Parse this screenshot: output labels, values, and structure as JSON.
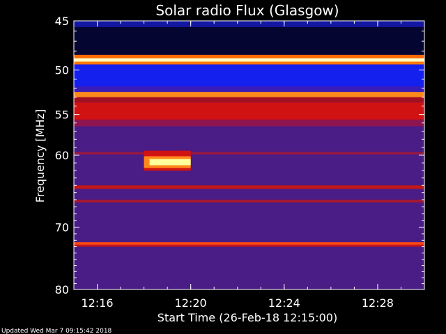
{
  "chart_data": {
    "type": "heatmap",
    "title": "Solar radio Flux (Glasgow)",
    "xlabel": "Start Time (26-Feb-18 12:15:00)",
    "ylabel": "Frequency [MHz]",
    "xlim": [
      "12:15",
      "12:30"
    ],
    "ylim": [
      45,
      80
    ],
    "y_scale": "log",
    "x_ticks": [
      "12:16",
      "12:20",
      "12:24",
      "12:28"
    ],
    "y_ticks": [
      45,
      50,
      55,
      60,
      70,
      80
    ],
    "background_color": "#4a1c86",
    "colors": {
      "dark": "#000028",
      "blue": "#1420ee",
      "purple": "#4a1c86",
      "red": "#d11212",
      "orange": "#ff8a1c",
      "yellow": "#ffff9c"
    },
    "bands": [
      {
        "from": 45,
        "to": 45.6,
        "color": "#1216a0"
      },
      {
        "from": 45.6,
        "to": 48.4,
        "color": "#050532"
      },
      {
        "from": 48.4,
        "to": 48.75,
        "color": "#ff6a00"
      },
      {
        "from": 48.75,
        "to": 49.1,
        "color": "#ffffc0"
      },
      {
        "from": 49.1,
        "to": 49.4,
        "color": "#ff7a00"
      },
      {
        "from": 49.4,
        "to": 51.8,
        "color": "#1420ee"
      },
      {
        "from": 51.8,
        "to": 52.4,
        "color": "#3a1cb8"
      },
      {
        "from": 52.4,
        "to": 53.0,
        "color": "#ff8a1c"
      },
      {
        "from": 53.0,
        "to": 53.6,
        "color": "#a01020"
      },
      {
        "from": 53.6,
        "to": 55.6,
        "color": "#d11212"
      },
      {
        "from": 55.6,
        "to": 56.4,
        "color": "#8e1450"
      },
      {
        "from": 59.6,
        "to": 59.9,
        "color": "#9c1840"
      },
      {
        "from": 64.0,
        "to": 64.5,
        "color": "#c01818"
      },
      {
        "from": 66.0,
        "to": 66.4,
        "color": "#a21832"
      },
      {
        "from": 72.3,
        "to": 72.7,
        "color": "#ff4a10"
      },
      {
        "from": 72.7,
        "to": 73.0,
        "color": "#c8141a"
      }
    ],
    "burst": {
      "time_start": "12:18",
      "time_end": "12:20",
      "freq_low": 60.5,
      "freq_high": 61.3,
      "core_color": "#ffff9c",
      "edge_color": "#ff8a1c"
    },
    "footer": "Updated Wed Mar  7 09:15:42 2018"
  }
}
